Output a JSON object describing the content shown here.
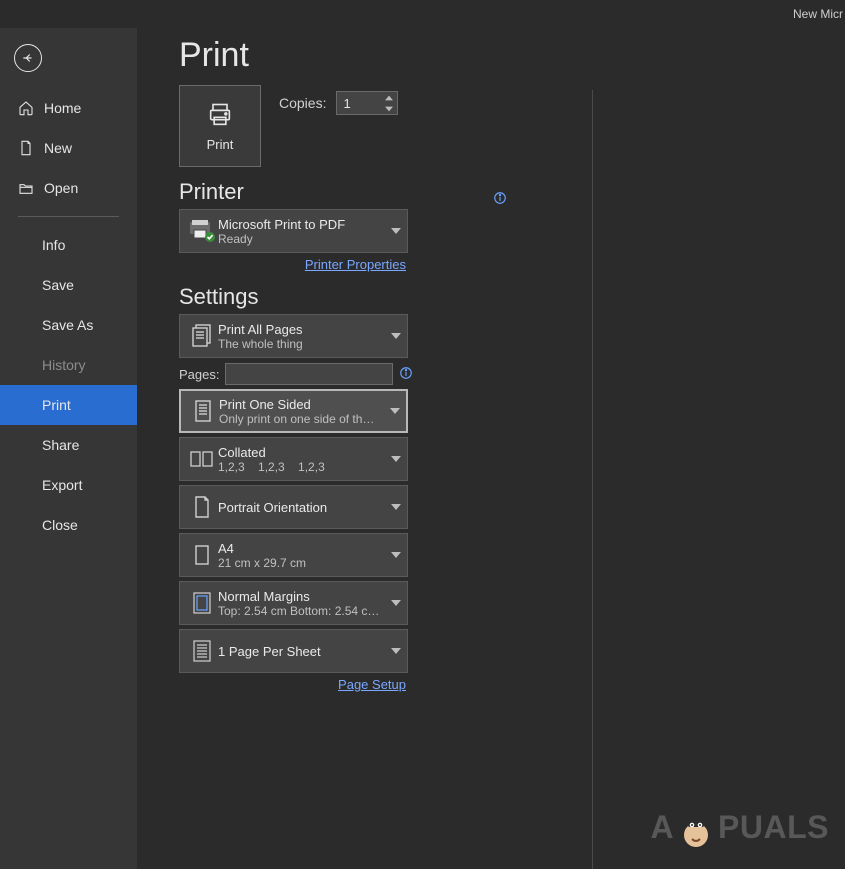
{
  "titlebar": {
    "doc_title": "New Micr"
  },
  "nav": {
    "home": "Home",
    "new": "New",
    "open": "Open",
    "info": "Info",
    "save": "Save",
    "saveas": "Save As",
    "history": "History",
    "print": "Print",
    "share": "Share",
    "export": "Export",
    "close": "Close"
  },
  "page": {
    "title": "Print"
  },
  "print_btn": {
    "label": "Print"
  },
  "copies": {
    "label": "Copies:",
    "value": "1"
  },
  "printer": {
    "heading": "Printer",
    "name": "Microsoft Print to PDF",
    "status": "Ready",
    "properties_link": "Printer Properties"
  },
  "settings": {
    "heading": "Settings",
    "range": {
      "title": "Print All Pages",
      "sub": "The whole thing"
    },
    "pages_label": "Pages:",
    "sides": {
      "title": "Print One Sided",
      "sub": "Only print on one side of th…"
    },
    "collate": {
      "title": "Collated",
      "sub": "1,2,3    1,2,3    1,2,3"
    },
    "orientation": {
      "title": "Portrait Orientation"
    },
    "paper": {
      "title": "A4",
      "sub": "21 cm x 29.7 cm"
    },
    "margins": {
      "title": "Normal Margins",
      "sub": "Top: 2.54 cm Bottom: 2.54 c…"
    },
    "persheet": {
      "title": "1 Page Per Sheet"
    },
    "page_setup_link": "Page Setup"
  },
  "watermark": {
    "a": "A",
    "p": "PUALS"
  }
}
